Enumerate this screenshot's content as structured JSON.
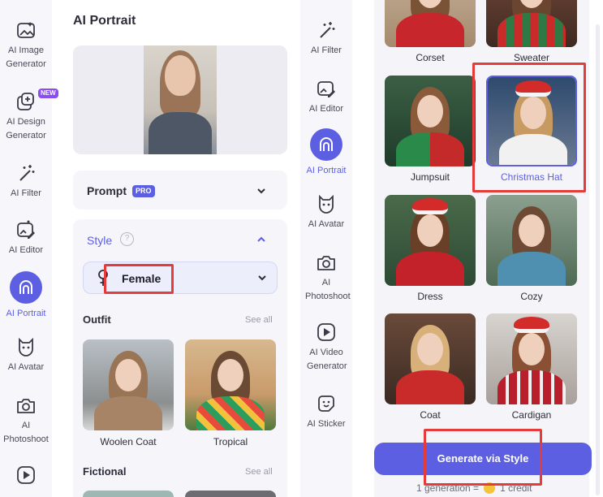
{
  "sidebar": {
    "items": [
      {
        "label": "AI Image Generator",
        "icon": "image-sparkle-icon"
      },
      {
        "label": "AI Design Generator",
        "icon": "design-icon",
        "badge": "NEW"
      },
      {
        "label": "AI Filter",
        "icon": "magic-wand-icon"
      },
      {
        "label": "AI Editor",
        "icon": "image-edit-icon"
      },
      {
        "label": "AI Portrait",
        "icon": "portrait-icon",
        "active": true
      },
      {
        "label": "AI Avatar",
        "icon": "avatar-icon"
      },
      {
        "label": "AI Photoshoot",
        "icon": "camera-icon"
      }
    ]
  },
  "panel": {
    "title": "AI Portrait",
    "prompt": {
      "label": "Prompt",
      "badge": "PRO"
    },
    "style": {
      "label": "Style",
      "help": "?",
      "selected_gender": "Female"
    },
    "outfit": {
      "title": "Outfit",
      "see_all": "See all",
      "items": [
        {
          "label": "Woolen Coat"
        },
        {
          "label": "Tropical"
        }
      ]
    },
    "fictional": {
      "title": "Fictional",
      "see_all": "See all"
    }
  },
  "rail2": {
    "items": [
      {
        "label": "AI Filter",
        "icon": "magic-wand-icon"
      },
      {
        "label": "AI Editor",
        "icon": "image-edit-icon"
      },
      {
        "label": "AI Portrait",
        "icon": "portrait-icon",
        "active": true
      },
      {
        "label": "AI Avatar",
        "icon": "avatar-icon"
      },
      {
        "label": "AI Photoshoot",
        "icon": "camera-icon"
      },
      {
        "label": "AI Video Generator",
        "icon": "video-play-icon"
      },
      {
        "label": "AI Sticker",
        "icon": "sticker-icon"
      }
    ]
  },
  "gallery": {
    "items": [
      {
        "label": "Corset"
      },
      {
        "label": "Sweater"
      },
      {
        "label": "Jumpsuit"
      },
      {
        "label": "Christmas Hat",
        "selected": true
      },
      {
        "label": "Dress"
      },
      {
        "label": "Cozy"
      },
      {
        "label": "Coat"
      },
      {
        "label": "Cardigan"
      }
    ]
  },
  "generate": {
    "button_label": "Generate via Style",
    "credit_prefix": "1 generation =",
    "credit_suffix": "1 credit"
  },
  "colors": {
    "accent": "#5d5fe3",
    "highlight": "#e63b3b",
    "badge_new": "#8b4cf0"
  }
}
